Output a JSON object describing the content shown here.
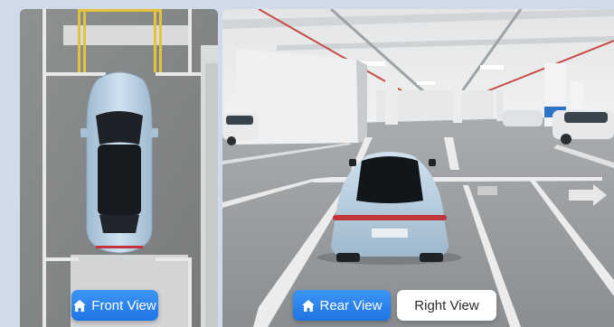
{
  "views": {
    "front": {
      "label": "Front View",
      "icon": "home-icon",
      "active": true
    },
    "rear": {
      "label": "Rear View",
      "icon": "home-icon",
      "active": true
    },
    "right": {
      "label": "Right View",
      "active": false
    }
  },
  "colors": {
    "accent": "#2a84ef",
    "car_body": "#b9d2e6",
    "parking_line_yellow": "#e4c23a",
    "parking_line_white": "#f2f2f2"
  }
}
